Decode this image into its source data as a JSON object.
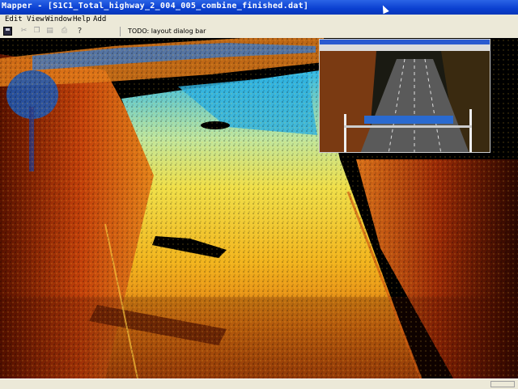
{
  "window": {
    "title": "Mapper - [S1C1_Total_highway_2_004_005_combine_finished.dat]"
  },
  "menu": {
    "items": [
      "Edit",
      "View",
      "Window",
      "Help",
      "Add"
    ]
  },
  "toolbar": {
    "icons": [
      "save-icon",
      "cut-icon",
      "copy-icon",
      "paste-icon",
      "print-icon",
      "help-icon"
    ],
    "status_text": "TODO: layout dialog bar"
  },
  "colors": {
    "title_bar": "#0a3fd0",
    "chrome": "#ece9d8",
    "cloud_low": "#8a1c00",
    "cloud_mid": "#e3a21a",
    "cloud_high": "#2a8aff"
  }
}
